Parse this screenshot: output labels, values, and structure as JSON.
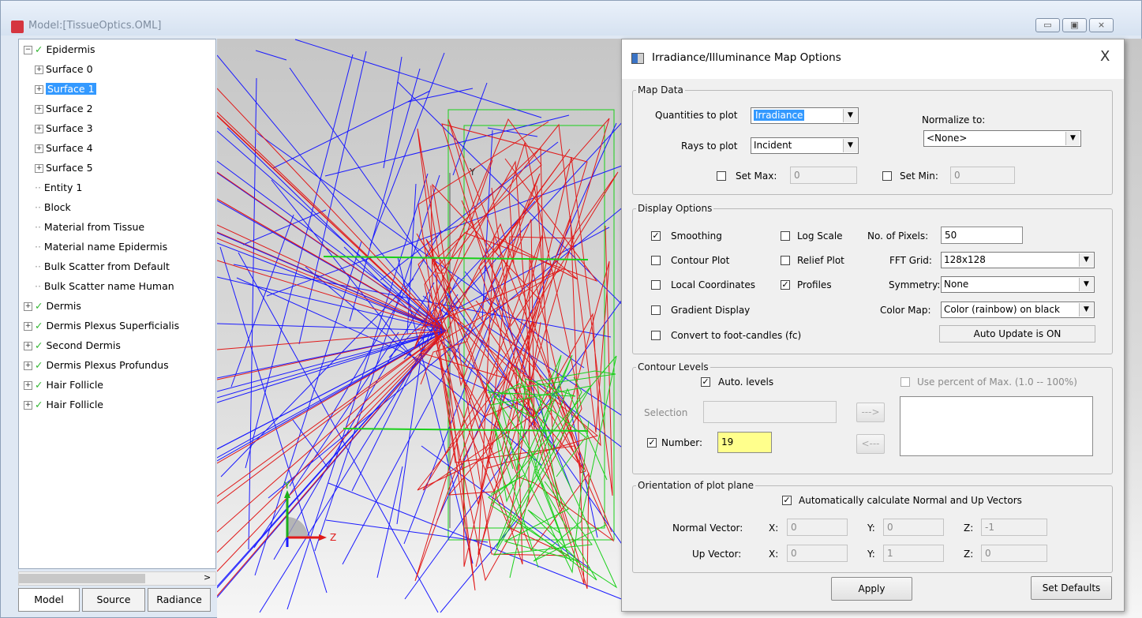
{
  "window": {
    "title": "Model:[TissueOptics.OML]",
    "controls": {
      "minimize": "▭",
      "maximize": "▣",
      "close": "⨯"
    }
  },
  "tree": {
    "items": [
      {
        "label": "Epidermis",
        "level": 0,
        "expander": "−",
        "check": true
      },
      {
        "label": "Surface 0",
        "level": 1,
        "expander": "+"
      },
      {
        "label": "Surface 1",
        "level": 1,
        "expander": "+",
        "selected": true
      },
      {
        "label": "Surface 2",
        "level": 1,
        "expander": "+"
      },
      {
        "label": "Surface 3",
        "level": 1,
        "expander": "+"
      },
      {
        "label": "Surface 4",
        "level": 1,
        "expander": "+"
      },
      {
        "label": "Surface 5",
        "level": 1,
        "expander": "+"
      },
      {
        "label": "Entity 1",
        "level": 1,
        "expander": ""
      },
      {
        "label": "Block",
        "level": 1,
        "expander": ""
      },
      {
        "label": "Material from Tissue",
        "level": 1,
        "expander": ""
      },
      {
        "label": "Material name Epidermis",
        "level": 1,
        "expander": ""
      },
      {
        "label": "Bulk Scatter from Default",
        "level": 1,
        "expander": ""
      },
      {
        "label": "Bulk Scatter name Human",
        "level": 1,
        "expander": ""
      },
      {
        "label": "Dermis",
        "level": 0,
        "expander": "+",
        "check": true
      },
      {
        "label": "Dermis Plexus Superficialis",
        "level": 0,
        "expander": "+",
        "check": true
      },
      {
        "label": "Second Dermis",
        "level": 0,
        "expander": "+",
        "check": true
      },
      {
        "label": "Dermis Plexus Profundus",
        "level": 0,
        "expander": "+",
        "check": true
      },
      {
        "label": "Hair Follicle",
        "level": 0,
        "expander": "+",
        "check": true
      },
      {
        "label": "Hair Follicle",
        "level": 0,
        "expander": "+",
        "check": true
      }
    ],
    "scroll_left": "<",
    "scroll_right": ">"
  },
  "tabs": [
    "Model",
    "Source",
    "Radiance"
  ],
  "viewport": {
    "axis_y_label": "Y",
    "axis_z_label": "Z",
    "axis_y_small": "Y"
  },
  "dialog": {
    "title": "Irradiance/Illuminance Map Options",
    "close": "X",
    "map_data": {
      "legend": "Map Data",
      "quantities_label": "Quantities to plot",
      "quantities_value": "Irradiance",
      "rays_label": "Rays to plot",
      "rays_value": "Incident",
      "normalize_label": "Normalize to:",
      "normalize_value": "<None>",
      "set_max_label": "Set Max:",
      "set_max_value": "0",
      "set_min_label": "Set Min:",
      "set_min_value": "0"
    },
    "display": {
      "legend": "Display Options",
      "smoothing": "Smoothing",
      "log_scale": "Log Scale",
      "contour_plot": "Contour Plot",
      "relief_plot": "Relief Plot",
      "local_coords": "Local Coordinates",
      "profiles": "Profiles",
      "gradient": "Gradient Display",
      "convert_fc": "Convert to foot-candles (fc)",
      "pixels_label": "No. of Pixels:",
      "pixels_value": "50",
      "fft_label": "FFT Grid:",
      "fft_value": "128x128",
      "symmetry_label": "Symmetry:",
      "symmetry_value": "None",
      "colormap_label": "Color Map:",
      "colormap_value": "Color (rainbow) on black",
      "auto_update": "Auto Update is ON"
    },
    "contour": {
      "legend": "Contour Levels",
      "auto_levels": "Auto. levels",
      "use_percent": "Use percent of Max. (1.0 -- 100%)",
      "selection_label": "Selection",
      "number_label": "Number:",
      "number_value": "19",
      "add_arrow": "--->",
      "remove_arrow": "<---"
    },
    "orientation": {
      "legend": "Orientation of plot plane",
      "auto_calc": "Automatically calculate Normal and Up Vectors",
      "normal_label": "Normal Vector:",
      "up_label": "Up Vector:",
      "x_label": "X:",
      "y_label": "Y:",
      "z_label": "Z:",
      "normal": {
        "x": "0",
        "y": "0",
        "z": "-1"
      },
      "up": {
        "x": "0",
        "y": "1",
        "z": "0"
      }
    },
    "apply": "Apply",
    "set_defaults": "Set Defaults"
  },
  "colors": {
    "ray_blue": "#1a1aff",
    "ray_red": "#e01a1a",
    "ray_green": "#1ad01a",
    "selection": "#3399ff",
    "highlight_yellow": "#ffff8c"
  }
}
